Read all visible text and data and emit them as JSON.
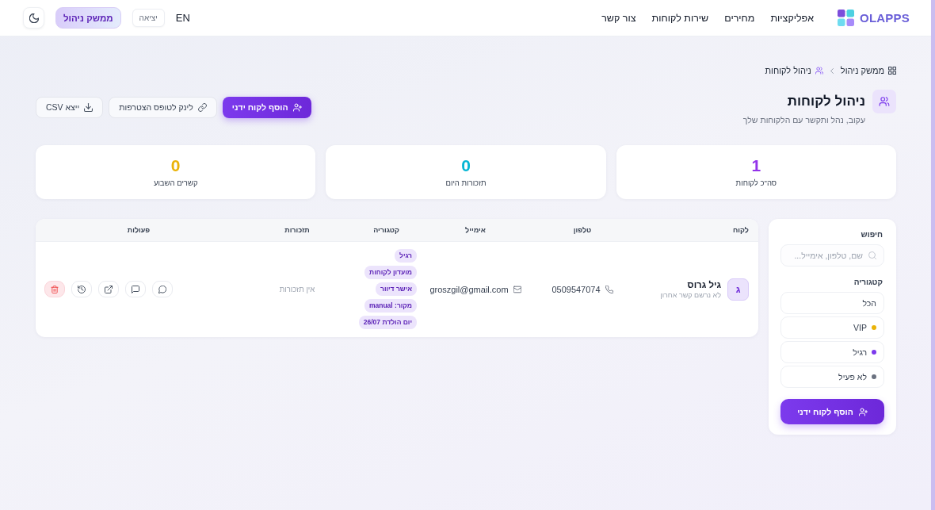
{
  "header": {
    "logo": "OLAPPS",
    "nav": [
      "אפליקציות",
      "מחירים",
      "שירות לקוחות",
      "צור קשר"
    ],
    "language": "EN",
    "logout": "יציאה",
    "admin_button": "ממשק ניהול"
  },
  "breadcrumb": [
    "ממשק ניהול",
    "ניהול לקוחות"
  ],
  "page": {
    "title": "ניהול לקוחות",
    "subtitle": "עקוב, נהל ותקשר עם הלקוחות שלך"
  },
  "actions": [
    {
      "kind": "add",
      "label": "הוסף לקוח ידני"
    },
    {
      "kind": "link",
      "label": "לינק לטופס הצטרפות"
    },
    {
      "kind": "export",
      "label": "ייצא CSV"
    }
  ],
  "stats": [
    {
      "value": "1",
      "label": "סה\"כ לקוחות",
      "color": "#9333ea"
    },
    {
      "value": "0",
      "label": "תזכורות היום",
      "color": "#06b6d4"
    },
    {
      "value": "0",
      "label": "קשרים השבוע",
      "color": "#eab308"
    }
  ],
  "filters": {
    "search_label": "חיפוש",
    "search": {
      "placeholder": "שם, טלפון, אימייל..."
    },
    "category_label": "קטגוריה",
    "categories": [
      {
        "label": "הכל",
        "selected": false
      },
      {
        "label": "VIP",
        "color": "#eab308",
        "selected": false
      },
      {
        "label": "רגיל",
        "color": "#7c3aed",
        "selected": false
      },
      {
        "label": "לא פעיל",
        "color": "#6b7280",
        "selected": false
      }
    ],
    "add_button": "הוסף לקוח ידני"
  },
  "table": {
    "columns": [
      "לקוח",
      "טלפון",
      "אימייל",
      "קטגוריה",
      "תזכורות",
      "פעולות"
    ],
    "rows": [
      {
        "initial": "ג",
        "name": "גיל גרוס",
        "last_contact": "לא נרשם קשר אחרון",
        "phone": "0509547074",
        "email": "groszgil@gmail.com",
        "tags": [
          "רגיל",
          "מועדון לקוחות",
          "אישר דיוור",
          "מקור: manual",
          "יום הולדת 26/07"
        ],
        "reminders": "אין תזכורות"
      }
    ]
  }
}
